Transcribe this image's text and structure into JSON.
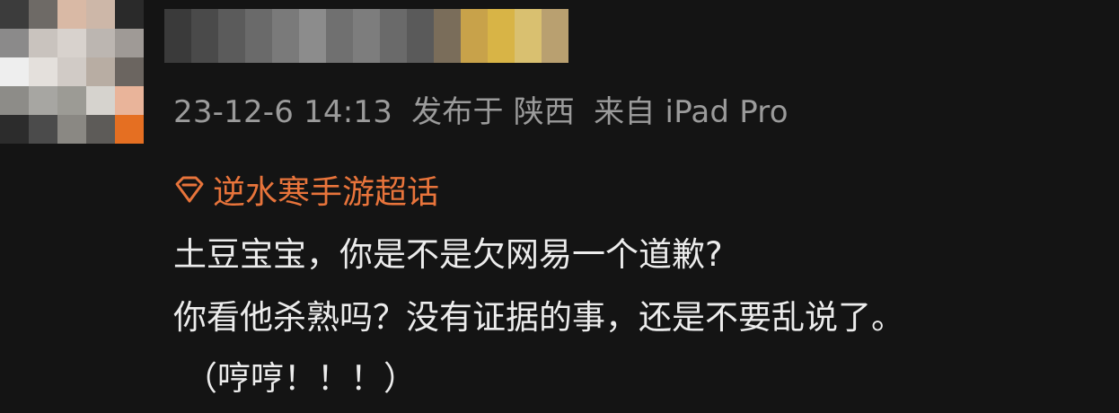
{
  "post": {
    "avatar_icon": "avatar-pixelated",
    "username_icon": "username-pixelated",
    "meta": {
      "time": "23-12-6 14:13",
      "location": "发布于 陕西",
      "device": "来自 iPad Pro"
    },
    "topic": {
      "icon": "diamond-icon",
      "label": "逆水寒手游超话",
      "color": "#e8743b"
    },
    "content_lines": [
      "土豆宝宝，你是不是欠网易一个道歉?",
      "你看他杀熟吗？没有证据的事，还是不要乱说了。",
      "（哼哼！！！）"
    ]
  }
}
